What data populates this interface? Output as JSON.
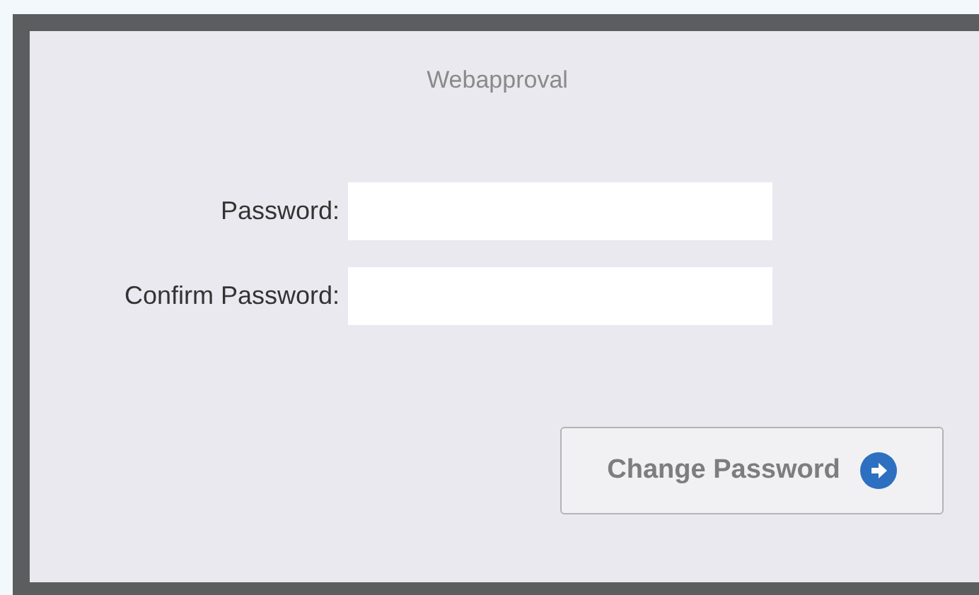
{
  "dialog": {
    "title": "Webapproval"
  },
  "fields": [
    {
      "label": "Password:"
    },
    {
      "label": "Confirm Password:"
    }
  ],
  "button": {
    "label": "Change Password"
  }
}
